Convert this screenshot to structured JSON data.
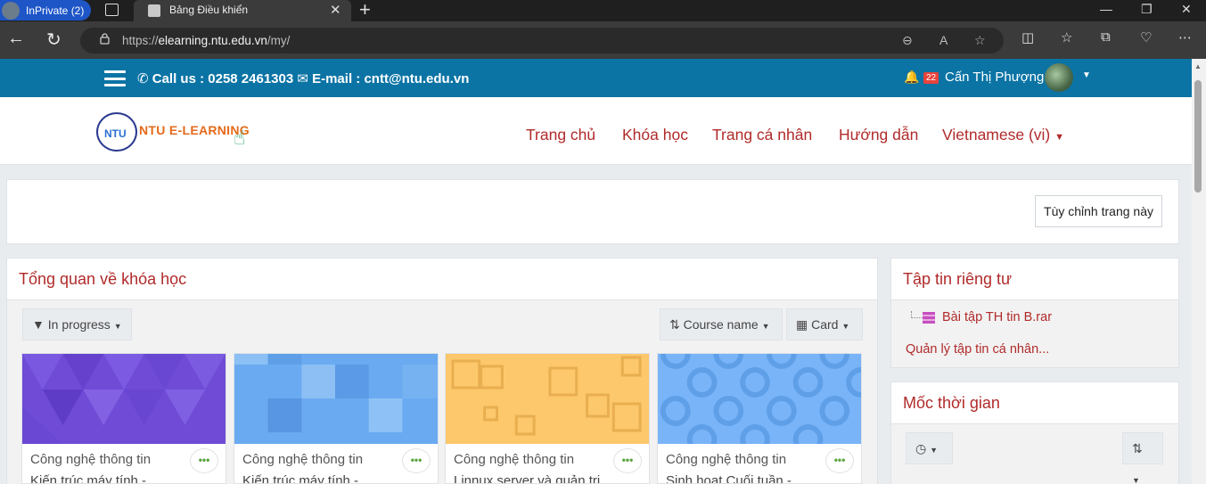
{
  "browser": {
    "inprivate_label": "InPrivate (2)",
    "tab_title": "Bảng Điều khiển",
    "url_prefix": "https://",
    "url_host": "elearning.ntu.edu.vn",
    "url_path": "/my/"
  },
  "topbar": {
    "contact": "Call us : 0258 2461303 ✉ E-mail : cntt@ntu.edu.vn",
    "notification_count": "22",
    "user_name": "Cấn Thị Phượng"
  },
  "logo": {
    "mark": "NTU",
    "text": "NTU E-LEARNING"
  },
  "nav": {
    "items": [
      "Trang chủ",
      "Khóa học",
      "Trang cá nhân",
      "Hướng dẫn",
      "Vietnamese (vi)"
    ]
  },
  "customize_button": "Tùy chỉnh trang này",
  "course_overview": {
    "title": "Tổng quan về khóa học",
    "filter_label": "In progress",
    "sort_label": "Course name",
    "view_label": "Card",
    "courses": [
      {
        "category": "Công nghệ thông tin",
        "name": "Kiến trúc máy tính -",
        "color": "#6f4bd6"
      },
      {
        "category": "Công nghệ thông tin",
        "name": "Kiến trúc máy tính -",
        "color": "#6aaaf0"
      },
      {
        "category": "Công nghệ thông tin",
        "name": "Linnux server và quản trị",
        "color": "#fcc86b"
      },
      {
        "category": "Công nghệ thông tin",
        "name": "Sinh hoạt Cuối tuần -",
        "color": "#79b4f8"
      }
    ]
  },
  "private_files": {
    "title": "Tập tin riêng tư",
    "file_name": "Bài tập TH tin B.rar",
    "manage_link": "Quản lý tập tin cá nhân..."
  },
  "timeline": {
    "title": "Mốc thời gian"
  }
}
